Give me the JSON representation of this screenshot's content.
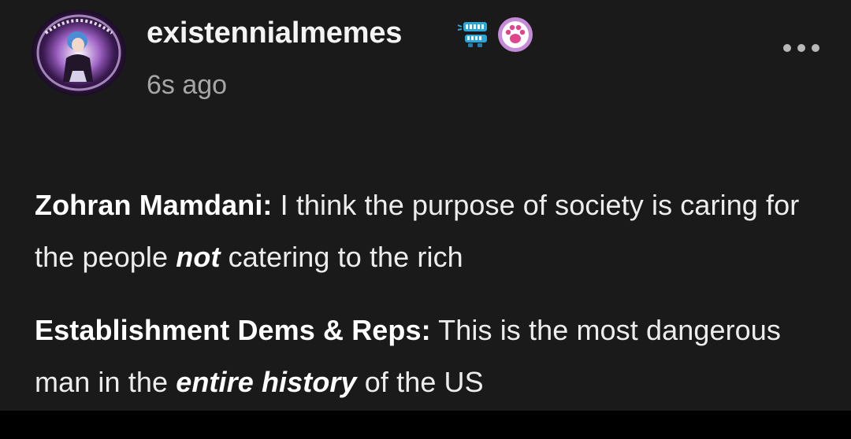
{
  "post": {
    "author": {
      "username": "existennialmemes",
      "avatar_icon": "circular-avatar-art",
      "badges": [
        {
          "name": "teeth-badge-icon"
        },
        {
          "name": "paw-badge-icon",
          "color": "#c58bd9"
        }
      ]
    },
    "timestamp": "6s ago",
    "menu_icon": "more-options-icon",
    "paragraphs": [
      {
        "speaker": "Zohran Mamdani:",
        "text_before": " I think the purpose of society is caring for the people ",
        "emphasis": "not",
        "text_after": " catering to the rich"
      },
      {
        "speaker": "Establishment Dems & Reps:",
        "text_before": " This is the most dangerous man in the ",
        "emphasis": "entire history",
        "text_after": " of the US"
      }
    ]
  },
  "colors": {
    "background": "#1a1a1b",
    "text": "#ededed",
    "secondary_text": "#a6a6a6"
  }
}
